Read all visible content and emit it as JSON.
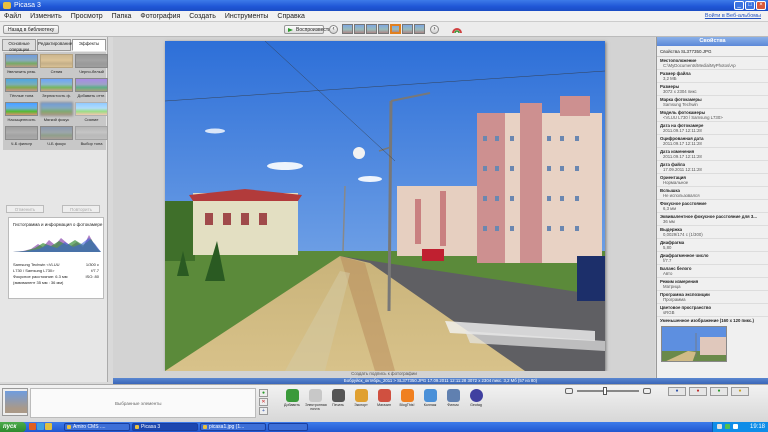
{
  "window": {
    "title": "Picasa 3"
  },
  "menu": {
    "items": [
      "Файл",
      "Изменить",
      "Просмотр",
      "Папка",
      "Фотография",
      "Создать",
      "Инструменты",
      "Справка"
    ],
    "signin": "Войти в Веб-альбомы"
  },
  "toolbar": {
    "back": "Назад в библиотеку",
    "play": "Воспроизвести",
    "prev": "‹",
    "next": "›"
  },
  "left_panel": {
    "tabs": [
      "Основные операции",
      "Редактирование",
      "Эффекты"
    ],
    "effects": [
      "Увеличить резк.",
      "Сепия",
      "Черно-белый",
      "Тёплые тона",
      "Зернистость ф.",
      "Добавить отте.",
      "Насыщенность",
      "Мягкий фокус",
      "Сияние",
      "Ч-Б фильтр",
      "Ч-Б фокус",
      "Выбор тона"
    ],
    "undo": "Отменить",
    "redo": "Повторить",
    "histogram_title": "Гистограмма и информация о фотокамере",
    "camera_rows": [
      {
        "label": "Samsung Techwin <VLUU",
        "value": "1/300 с"
      },
      {
        "label": "L730 / Samsung L730>",
        "value": "f/7.7"
      },
      {
        "label": "Фокусное расстояние: 6.3 мм",
        "value": "ISO: 80"
      },
      {
        "label": "(эквивалент 35 мм : 36 мм)",
        "value": ""
      }
    ]
  },
  "main": {
    "caption": "Создать подпись к фотографии"
  },
  "right_panel": {
    "header": "Свойства",
    "file": "Свойства SL377350.JPG",
    "props": [
      {
        "k": "Местоположение",
        "v": "C:\\MyDocuments\\Media\\MyPhotos\\Ар"
      },
      {
        "k": "Размер файла",
        "v": "3,2 МБ"
      },
      {
        "k": "Размеры",
        "v": "3072 x 2304 пикс"
      },
      {
        "k": "Марка фотокамеры",
        "v": "Samsung Techwin"
      },
      {
        "k": "Модель фотокамеры",
        "v": "<VLUU L730 / Samsung L730>"
      },
      {
        "k": "Дата на фотокамере",
        "v": "2011.09.17 12:11:28"
      },
      {
        "k": "Оцифрованная дата",
        "v": "2011.09.17 12:11:28"
      },
      {
        "k": "Дата изменения",
        "v": "2011.09.17 12:11:28"
      },
      {
        "k": "Дата файла",
        "v": "17.09.2011 12:11:28"
      },
      {
        "k": "Ориентация",
        "v": "Нормальное"
      },
      {
        "k": "Вспышка",
        "v": "Не использовался"
      },
      {
        "k": "Фокусное расстояние",
        "v": "6,3 мм"
      },
      {
        "k": "Эквивалентное фокусное расстояние для 3...",
        "v": "36 мм"
      },
      {
        "k": "Выдержка",
        "v": "0,0029/174 с (1/300)"
      },
      {
        "k": "Диафрагма",
        "v": "5,80"
      },
      {
        "k": "Диафрагменное число",
        "v": "f/7.7"
      },
      {
        "k": "Баланс белого",
        "v": "Авто"
      },
      {
        "k": "Режим измерения",
        "v": "Матрица"
      },
      {
        "k": "Программа экспозиции",
        "v": "Программа"
      },
      {
        "k": "Цветовое пространство",
        "v": "sRGB"
      },
      {
        "k": "Уменьшенное изображение (160 x 120 пикс.)",
        "v": ""
      }
    ]
  },
  "status": {
    "text": "Бобруйск_октябрь_2011 > SL377350.JPG   17.09.2011 12:11:28   3072 x 2304 пикс.   3,2 Мб   (57 из 80)"
  },
  "bottom": {
    "selection_label": "Выбранные элементы",
    "actions": [
      "Добавить",
      "Электронная почта",
      "Печать",
      "Экспорт",
      "Магазин",
      "BlogThis!",
      "Коллаж",
      "Фильм",
      "Geotag"
    ],
    "action_colors": [
      "#3a9a3a",
      "#c8c8c8",
      "#555555",
      "#e0a030",
      "#d05040",
      "#f08020",
      "#4a90d8",
      "#6080b0",
      "#4040a0"
    ]
  },
  "taskbar": {
    "start": "пуск",
    "tasks": [
      "Amiro CMS ....",
      "Picasa 3",
      "picasa1.jpg (1...",
      ""
    ],
    "clock": "19:18"
  }
}
